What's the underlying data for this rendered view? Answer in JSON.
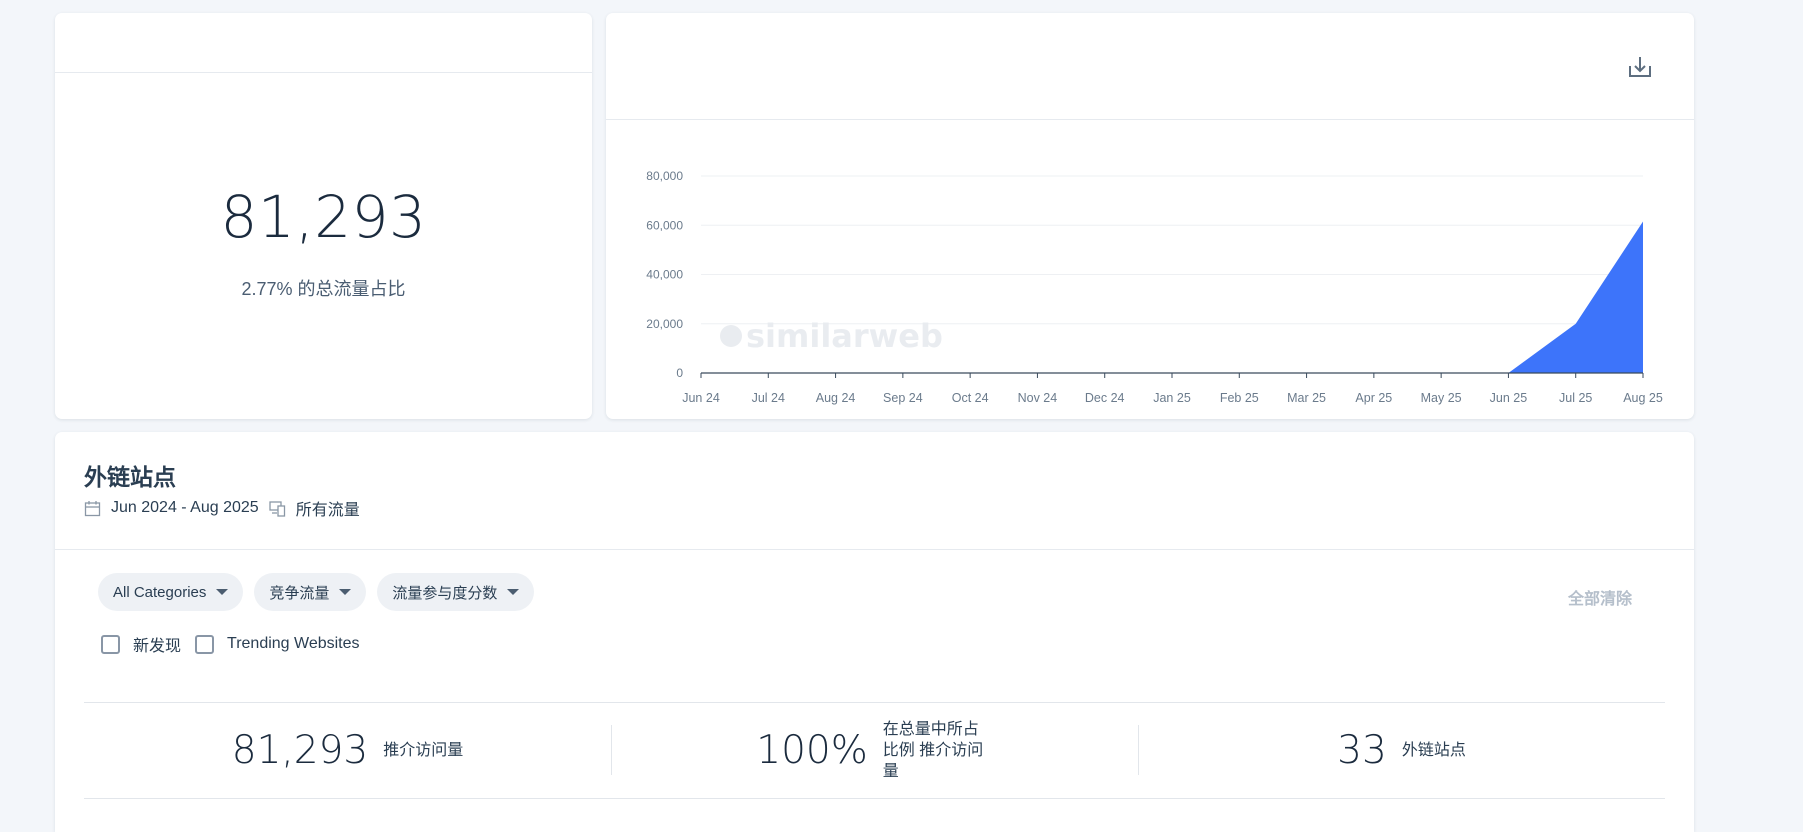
{
  "kpi": {
    "value": "81,293",
    "subtitle": "2.77% 的总流量占比"
  },
  "chart_data": {
    "type": "area",
    "x": [
      "Jun 24",
      "Jul 24",
      "Aug 24",
      "Sep 24",
      "Oct 24",
      "Nov 24",
      "Dec 24",
      "Jan 25",
      "Feb 25",
      "Mar 25",
      "Apr 25",
      "May 25",
      "Jun 25",
      "Jul 25",
      "Aug 25"
    ],
    "values": [
      0,
      0,
      0,
      0,
      0,
      0,
      0,
      0,
      0,
      0,
      0,
      0,
      0,
      20000,
      61500
    ],
    "yticks": [
      "0",
      "20,000",
      "40,000",
      "60,000",
      "80,000"
    ],
    "ylim": [
      0,
      80000
    ],
    "grid": true,
    "watermark": "similarweb",
    "fill_color": "#3d74fa"
  },
  "backlinks": {
    "title": "外链站点",
    "date_range": "Jun 2024 - Aug 2025",
    "traffic_type": "所有流量",
    "filters": [
      "All Categories",
      "竞争流量",
      "流量参与度分数"
    ],
    "clear_all": "全部清除",
    "checkboxes": [
      "新发现",
      "Trending Websites"
    ],
    "stats": [
      {
        "value": "81,293",
        "label": "推介访问量"
      },
      {
        "value": "100%",
        "label": "在总量中所占比例 推介访问量"
      },
      {
        "value": "33",
        "label": "外链站点"
      }
    ]
  }
}
